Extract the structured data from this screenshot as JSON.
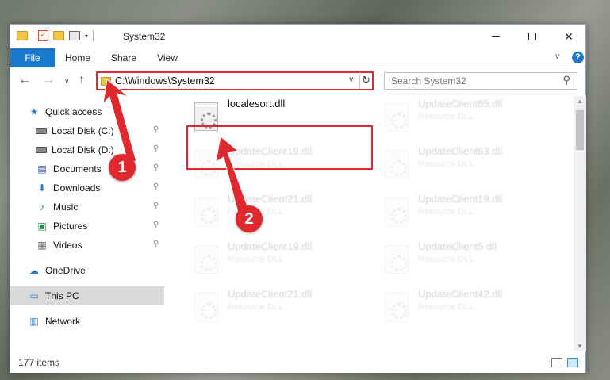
{
  "window": {
    "title": "System32",
    "controls": {
      "minimize": "–",
      "maximize": "□",
      "close": "✕"
    }
  },
  "ribbon": {
    "tabs": [
      "File",
      "Home",
      "Share",
      "View"
    ],
    "help": "?",
    "expand": "∨"
  },
  "nav": {
    "path": "C:\\Windows\\System32",
    "search_placeholder": "Search System32",
    "back": "←",
    "forward": "→",
    "recent": "∨",
    "up": "↑",
    "refresh": "↻",
    "dropdown": "∨",
    "search_icon": "⚲"
  },
  "sidebar": {
    "items": [
      {
        "label": "Quick access",
        "icon": "star-icon",
        "glyph": "★",
        "pin": false
      },
      {
        "label": "Local Disk (C:)",
        "icon": "drive-icon",
        "glyph": "",
        "pin": true
      },
      {
        "label": "Local Disk (D:)",
        "icon": "drive-icon",
        "glyph": "",
        "pin": true
      },
      {
        "label": "Documents",
        "icon": "documents-icon",
        "glyph": "▤",
        "pin": true
      },
      {
        "label": "Downloads",
        "icon": "downloads-icon",
        "glyph": "⬇",
        "pin": true
      },
      {
        "label": "Music",
        "icon": "music-icon",
        "glyph": "♪",
        "pin": true
      },
      {
        "label": "Pictures",
        "icon": "pictures-icon",
        "glyph": "▣",
        "pin": true
      },
      {
        "label": "Videos",
        "icon": "videos-icon",
        "glyph": "▦",
        "pin": true
      },
      {
        "label": "OneDrive",
        "icon": "onedrive-icon",
        "glyph": "☁",
        "pin": false
      },
      {
        "label": "This PC",
        "icon": "this-pc-icon",
        "glyph": "▭",
        "pin": false
      },
      {
        "label": "Network",
        "icon": "network-icon",
        "glyph": "▥",
        "pin": false
      }
    ],
    "pin_glyph": "📌"
  },
  "files": [
    {
      "name": "localesort.dll",
      "type": ""
    },
    {
      "name": "UpdateClient65.dll",
      "type": "Resource DLL"
    },
    {
      "name": "UpdateClient19.dll",
      "type": "Resource DLL"
    },
    {
      "name": "UpdateClient63.dll",
      "type": "Resource DLL"
    },
    {
      "name": "UpdateClient21.dll",
      "type": "Resource DLL"
    },
    {
      "name": "UpdateClient19.dll",
      "type": "Resource DLL"
    },
    {
      "name": "UpdateClient19.dll",
      "type": "Resource DLL"
    },
    {
      "name": "UpdateClient5.dll",
      "type": "Resource DLL"
    },
    {
      "name": "UpdateClient21.dll",
      "type": "Resource DLL"
    },
    {
      "name": "UpdateClient42.dll",
      "type": "Resource DLL"
    }
  ],
  "status": {
    "count": "177 items"
  },
  "annotations": {
    "step1": "1",
    "step2": "2",
    "color": "#e0282e"
  }
}
